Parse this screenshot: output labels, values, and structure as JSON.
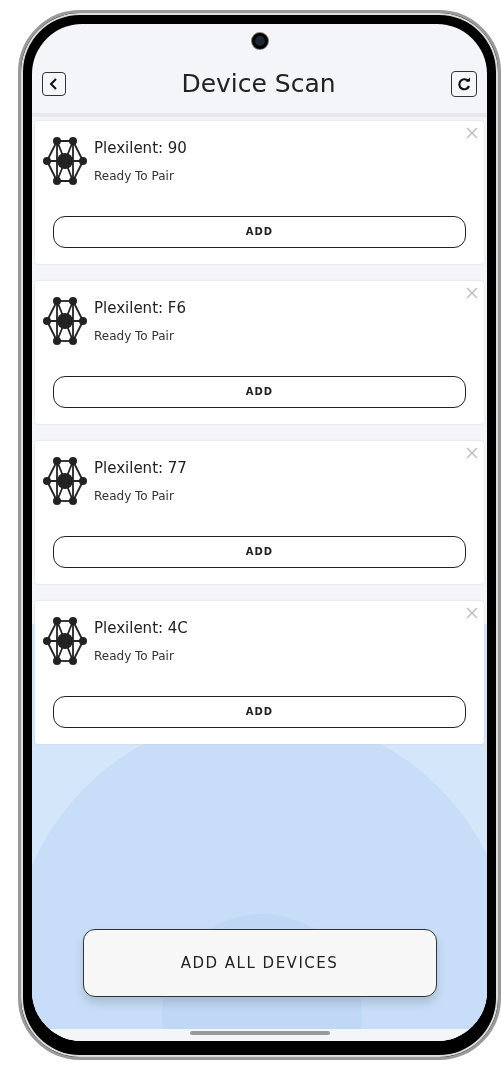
{
  "header": {
    "title": "Device Scan"
  },
  "devices": [
    {
      "name": "Plexilent: 90",
      "status": "Ready To Pair",
      "action": "ADD"
    },
    {
      "name": "Plexilent: F6",
      "status": "Ready To Pair",
      "action": "ADD"
    },
    {
      "name": "Plexilent: 77",
      "status": "Ready To Pair",
      "action": "ADD"
    },
    {
      "name": "Plexilent: 4C",
      "status": "Ready To Pair",
      "action": "ADD"
    }
  ],
  "footer": {
    "button": "ADD ALL DEVICES"
  }
}
